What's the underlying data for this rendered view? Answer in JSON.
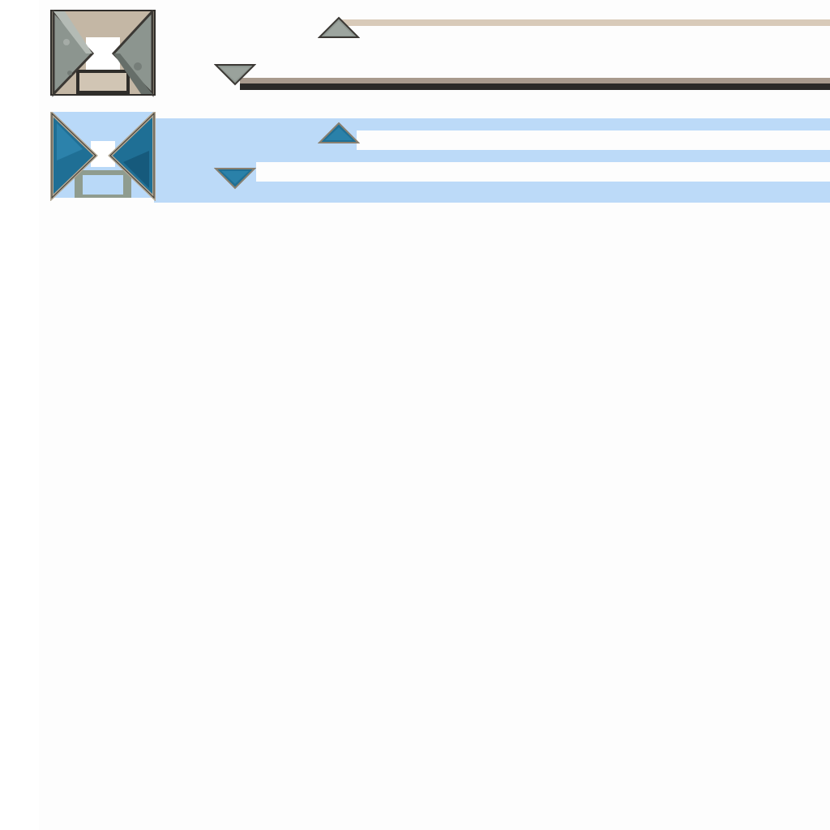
{
  "sprite_sheet": {
    "variants": [
      {
        "id": "stone",
        "colors": {
          "face": "#8a938e",
          "face_light": "#a7aea9",
          "face_dark": "#69716d",
          "rim": "#cbbfae",
          "rim_dark": "#3c3833",
          "band_top": "#d6c8b6",
          "band_bottom": "#a4968a",
          "band_shadow": "#2a2826"
        },
        "state": "normal"
      },
      {
        "id": "sapphire",
        "colors": {
          "face": "#1f6f95",
          "face_light": "#3a8fb6",
          "face_dark": "#134e6c",
          "rim": "#b7ab98",
          "rim_dark": "#3a3834",
          "highlight_bg": "#b8d8f8",
          "band": "#c3dcf7"
        },
        "state": "selected"
      }
    ],
    "icons": [
      "collapse-icon",
      "arrow-up-icon",
      "arrow-down-icon"
    ]
  }
}
